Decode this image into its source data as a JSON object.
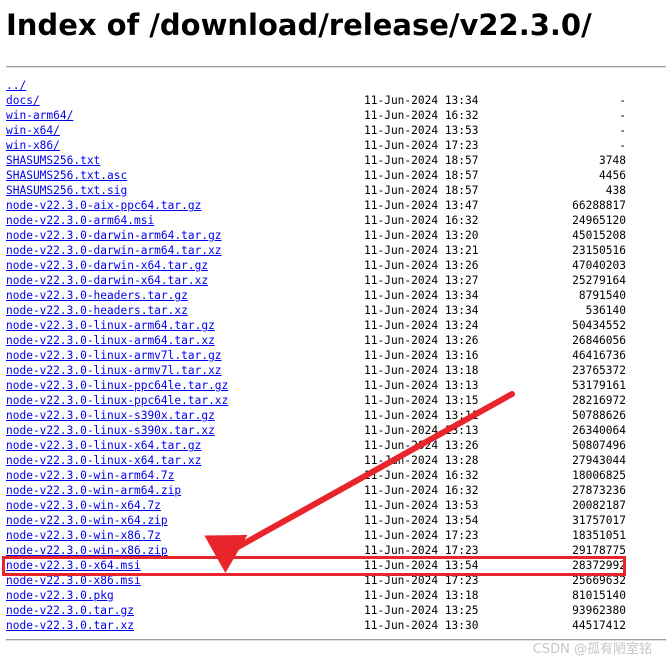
{
  "page": {
    "title": "Index of /download/release/v22.3.0/"
  },
  "listing": {
    "rows": [
      {
        "name": "../",
        "date": "",
        "size": ""
      },
      {
        "name": "docs/",
        "date": "11-Jun-2024 13:34",
        "size": "-"
      },
      {
        "name": "win-arm64/",
        "date": "11-Jun-2024 16:32",
        "size": "-"
      },
      {
        "name": "win-x64/",
        "date": "11-Jun-2024 13:53",
        "size": "-"
      },
      {
        "name": "win-x86/",
        "date": "11-Jun-2024 17:23",
        "size": "-"
      },
      {
        "name": "SHASUMS256.txt",
        "date": "11-Jun-2024 18:57",
        "size": "3748"
      },
      {
        "name": "SHASUMS256.txt.asc",
        "date": "11-Jun-2024 18:57",
        "size": "4456"
      },
      {
        "name": "SHASUMS256.txt.sig",
        "date": "11-Jun-2024 18:57",
        "size": "438"
      },
      {
        "name": "node-v22.3.0-aix-ppc64.tar.gz",
        "date": "11-Jun-2024 13:47",
        "size": "66288817"
      },
      {
        "name": "node-v22.3.0-arm64.msi",
        "date": "11-Jun-2024 16:32",
        "size": "24965120"
      },
      {
        "name": "node-v22.3.0-darwin-arm64.tar.gz",
        "date": "11-Jun-2024 13:20",
        "size": "45015208"
      },
      {
        "name": "node-v22.3.0-darwin-arm64.tar.xz",
        "date": "11-Jun-2024 13:21",
        "size": "23150516"
      },
      {
        "name": "node-v22.3.0-darwin-x64.tar.gz",
        "date": "11-Jun-2024 13:26",
        "size": "47040203"
      },
      {
        "name": "node-v22.3.0-darwin-x64.tar.xz",
        "date": "11-Jun-2024 13:27",
        "size": "25279164"
      },
      {
        "name": "node-v22.3.0-headers.tar.gz",
        "date": "11-Jun-2024 13:34",
        "size": "8791540"
      },
      {
        "name": "node-v22.3.0-headers.tar.xz",
        "date": "11-Jun-2024 13:34",
        "size": "536140"
      },
      {
        "name": "node-v22.3.0-linux-arm64.tar.gz",
        "date": "11-Jun-2024 13:24",
        "size": "50434552"
      },
      {
        "name": "node-v22.3.0-linux-arm64.tar.xz",
        "date": "11-Jun-2024 13:26",
        "size": "26846056"
      },
      {
        "name": "node-v22.3.0-linux-armv7l.tar.gz",
        "date": "11-Jun-2024 13:16",
        "size": "46416736"
      },
      {
        "name": "node-v22.3.0-linux-armv7l.tar.xz",
        "date": "11-Jun-2024 13:18",
        "size": "23765372"
      },
      {
        "name": "node-v22.3.0-linux-ppc64le.tar.gz",
        "date": "11-Jun-2024 13:13",
        "size": "53179161"
      },
      {
        "name": "node-v22.3.0-linux-ppc64le.tar.xz",
        "date": "11-Jun-2024 13:15",
        "size": "28216972"
      },
      {
        "name": "node-v22.3.0-linux-s390x.tar.gz",
        "date": "11-Jun-2024 13:11",
        "size": "50788626"
      },
      {
        "name": "node-v22.3.0-linux-s390x.tar.xz",
        "date": "11-Jun-2024 13:13",
        "size": "26340064"
      },
      {
        "name": "node-v22.3.0-linux-x64.tar.gz",
        "date": "11-Jun-2024 13:26",
        "size": "50807496"
      },
      {
        "name": "node-v22.3.0-linux-x64.tar.xz",
        "date": "11-Jun-2024 13:28",
        "size": "27943044"
      },
      {
        "name": "node-v22.3.0-win-arm64.7z",
        "date": "11-Jun-2024 16:32",
        "size": "18006825"
      },
      {
        "name": "node-v22.3.0-win-arm64.zip",
        "date": "11-Jun-2024 16:32",
        "size": "27873236"
      },
      {
        "name": "node-v22.3.0-win-x64.7z",
        "date": "11-Jun-2024 13:53",
        "size": "20082187"
      },
      {
        "name": "node-v22.3.0-win-x64.zip",
        "date": "11-Jun-2024 13:54",
        "size": "31757017"
      },
      {
        "name": "node-v22.3.0-win-x86.7z",
        "date": "11-Jun-2024 17:23",
        "size": "18351051"
      },
      {
        "name": "node-v22.3.0-win-x86.zip",
        "date": "11-Jun-2024 17:23",
        "size": "29178775"
      },
      {
        "name": "node-v22.3.0-x64.msi",
        "date": "11-Jun-2024 13:54",
        "size": "28372992"
      },
      {
        "name": "node-v22.3.0-x86.msi",
        "date": "11-Jun-2024 17:23",
        "size": "25669632"
      },
      {
        "name": "node-v22.3.0.pkg",
        "date": "11-Jun-2024 13:18",
        "size": "81015140"
      },
      {
        "name": "node-v22.3.0.tar.gz",
        "date": "11-Jun-2024 13:25",
        "size": "93962380"
      },
      {
        "name": "node-v22.3.0.tar.xz",
        "date": "11-Jun-2024 13:30",
        "size": "44517412"
      }
    ]
  },
  "annotation": {
    "highlighted_file": "node-v22.3.0-x64.msi",
    "color": "#e8252a"
  },
  "watermark": {
    "text": "CSDN @孤有陋室铭"
  }
}
